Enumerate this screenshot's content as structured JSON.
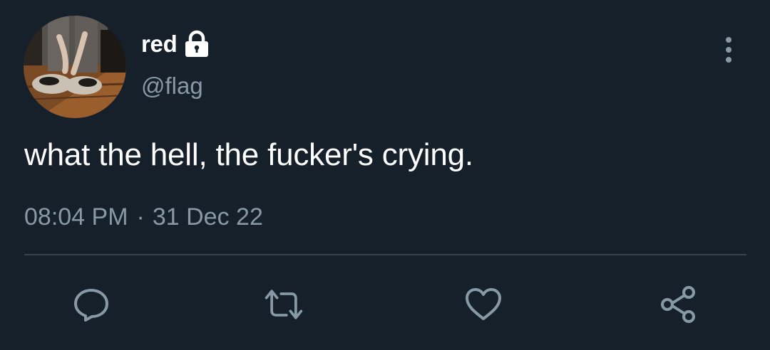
{
  "user": {
    "display_name": "red",
    "handle": "@flag",
    "protected_icon": "lock-icon",
    "avatar": "avatar-photo"
  },
  "tweet": {
    "text": "what the hell, the fucker's crying.",
    "time": "08:04 PM",
    "separator": "·",
    "date": "31 Dec 22"
  },
  "actions": [
    {
      "icon": "reply-icon"
    },
    {
      "icon": "retweet-icon"
    },
    {
      "icon": "like-icon"
    },
    {
      "icon": "share-icon"
    }
  ],
  "menu": {
    "icon": "more-options-icon"
  },
  "colors": {
    "background": "#15202b",
    "primary_text": "#ffffff",
    "secondary_text": "#8899a6",
    "divider": "#38444d"
  }
}
